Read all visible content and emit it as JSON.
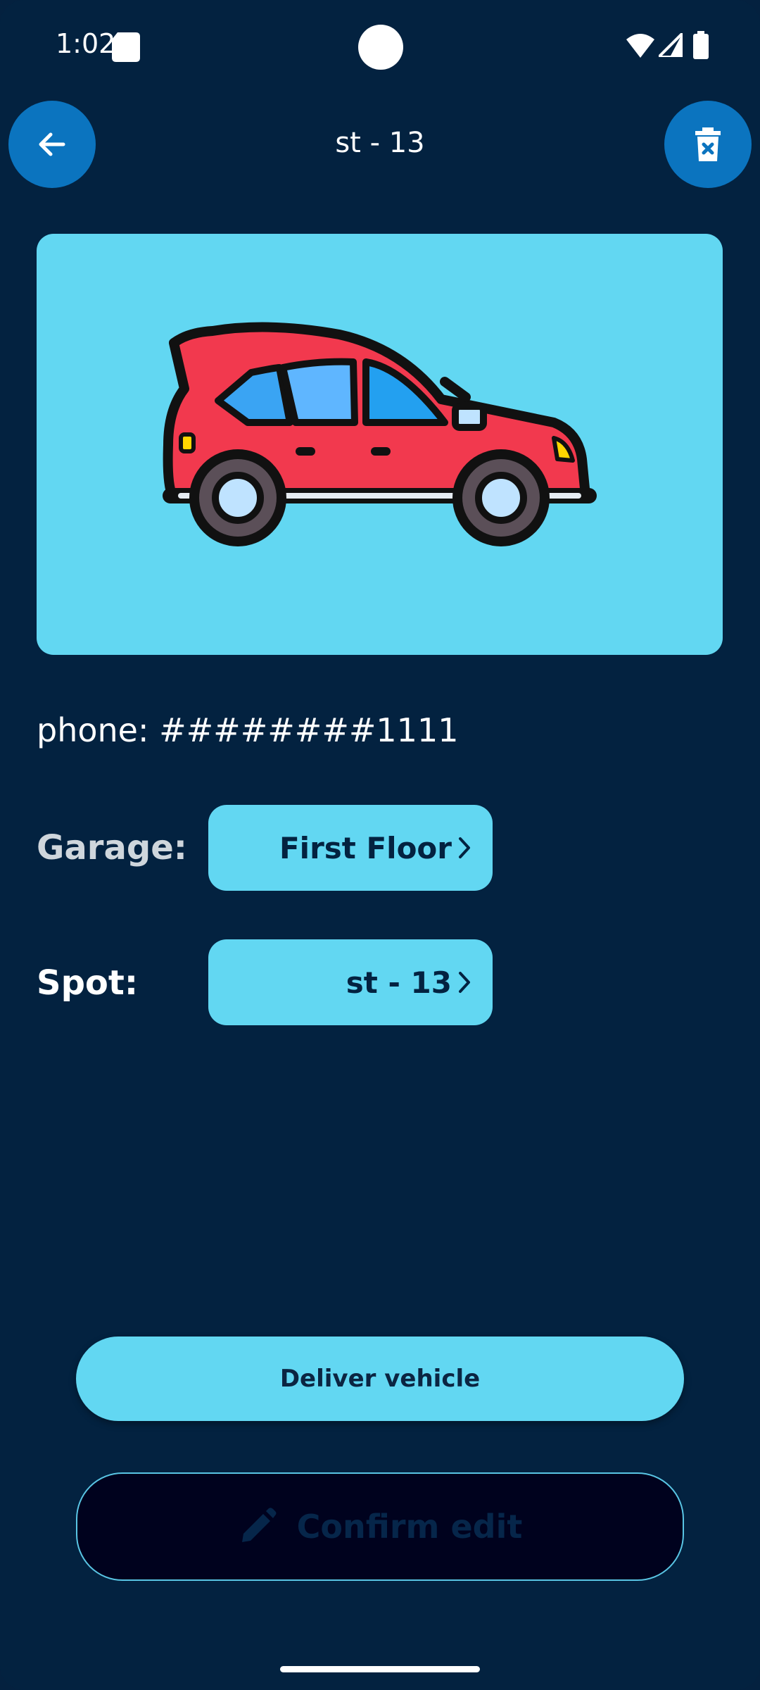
{
  "status_bar": {
    "time": "1:02",
    "icons": [
      "sd-card-icon",
      "wifi-icon",
      "signal-icon",
      "battery-icon"
    ]
  },
  "header": {
    "title": "st - 13",
    "back_icon": "arrow-left-icon",
    "delete_icon": "trash-x-icon"
  },
  "vehicle": {
    "image": "red-hatchback-car-illustration",
    "phone": "phone: ########1111"
  },
  "fields": {
    "garage_label": "Garage:",
    "garage_value": "First Floor",
    "spot_label": "Spot:",
    "spot_value": "st - 13"
  },
  "actions": {
    "deliver_label": "Deliver vehicle",
    "confirm_label": "Confirm edit",
    "confirm_icon": "pencil-icon"
  },
  "colors": {
    "background": "#032240",
    "accent": "#62d7f2",
    "button_blue": "#0b74bf",
    "confirm_bg": "#00021e"
  }
}
